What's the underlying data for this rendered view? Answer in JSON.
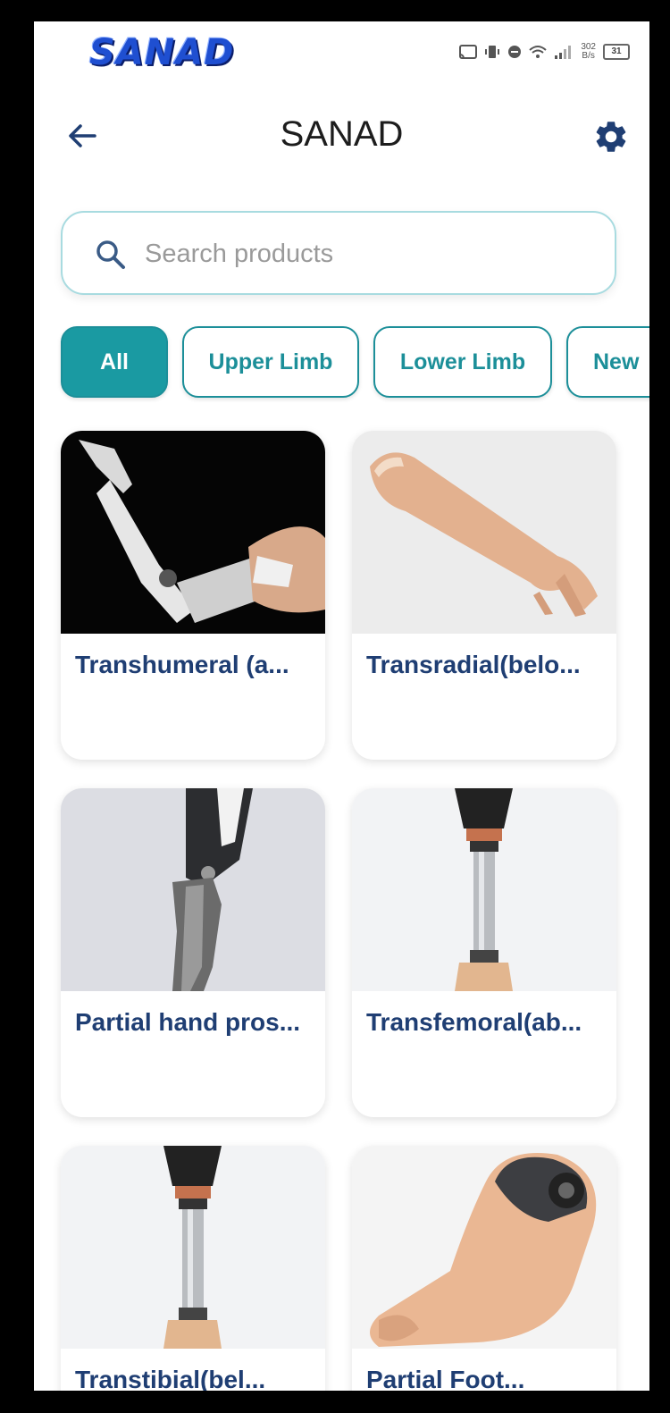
{
  "status_bar": {
    "logo_text": "SANAD",
    "net_speed_value": "302",
    "net_speed_unit": "B/s",
    "battery": "31"
  },
  "app_bar": {
    "title": "SANAD",
    "back_icon": "arrow-left-icon",
    "settings_icon": "gear-icon"
  },
  "search": {
    "placeholder": "Search products",
    "value": ""
  },
  "filters": {
    "selected": "All",
    "chips": [
      {
        "label": "All"
      },
      {
        "label": "Upper Limb"
      },
      {
        "label": "Lower Limb"
      },
      {
        "label": "New"
      }
    ]
  },
  "products": [
    {
      "name": "Transhumeral (a..."
    },
    {
      "name": "Transradial(belo..."
    },
    {
      "name": "Partial hand pros..."
    },
    {
      "name": "Transfemoral(ab..."
    },
    {
      "name": "Transtibial(bel..."
    },
    {
      "name": "Partial Foot..."
    }
  ],
  "colors": {
    "accent": "#1a9aa2",
    "title_text": "#1f3e73",
    "icon_blue": "#1f3e73"
  }
}
